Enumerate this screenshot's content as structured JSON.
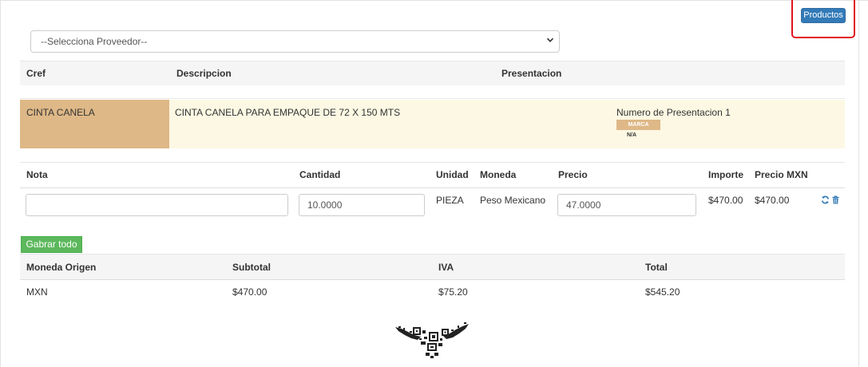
{
  "toolbar": {
    "productos_label": "Productos"
  },
  "proveedor_select": {
    "selected": "--Selecciona Proveedor--"
  },
  "product_table": {
    "headers": {
      "cref": "Cref",
      "descripcion": "Descripcion",
      "presentacion": "Presentacion"
    },
    "rows": [
      {
        "cref": "CINTA CANELA",
        "descripcion": "CINTA CANELA PARA EMPAQUE DE 72 X 150 MTS",
        "presentacion": "Numero de Presentacion 1",
        "marca_label": "MARCA",
        "marca_value": "N/A"
      }
    ]
  },
  "order_table": {
    "headers": {
      "nota": "Nota",
      "cantidad": "Cantidad",
      "unidad": "Unidad",
      "moneda": "Moneda",
      "precio": "Precio",
      "importe": "Importe",
      "precio_mxn": "Precio MXN"
    },
    "row": {
      "nota": "",
      "cantidad": "10.0000",
      "unidad": "PIEZA",
      "moneda": "Peso Mexicano",
      "precio": "47.0000",
      "importe": "$470.00",
      "precio_mxn": "$470.00"
    }
  },
  "actions": {
    "gabrar_label": "Gabrar todo"
  },
  "summary_table": {
    "headers": {
      "moneda_origen": "Moneda Origen",
      "subtotal": "Subtotal",
      "iva": "IVA",
      "total": "Total"
    },
    "row": {
      "moneda_origen": "MXN",
      "subtotal": "$470.00",
      "iva": "$75.20",
      "total": "$545.20"
    }
  },
  "icons": {
    "refresh": "refresh-icon",
    "delete": "trash-icon",
    "dropdown": "chevron-down-icon",
    "logo": "qr-eagle-logo"
  },
  "colors": {
    "primary": "#337ab7",
    "success": "#5cb85c",
    "cref_cell": "#deb887",
    "row_highlight": "#fcf8e3",
    "annotation": "#e0151e",
    "refresh_icon": "#337ab7"
  }
}
